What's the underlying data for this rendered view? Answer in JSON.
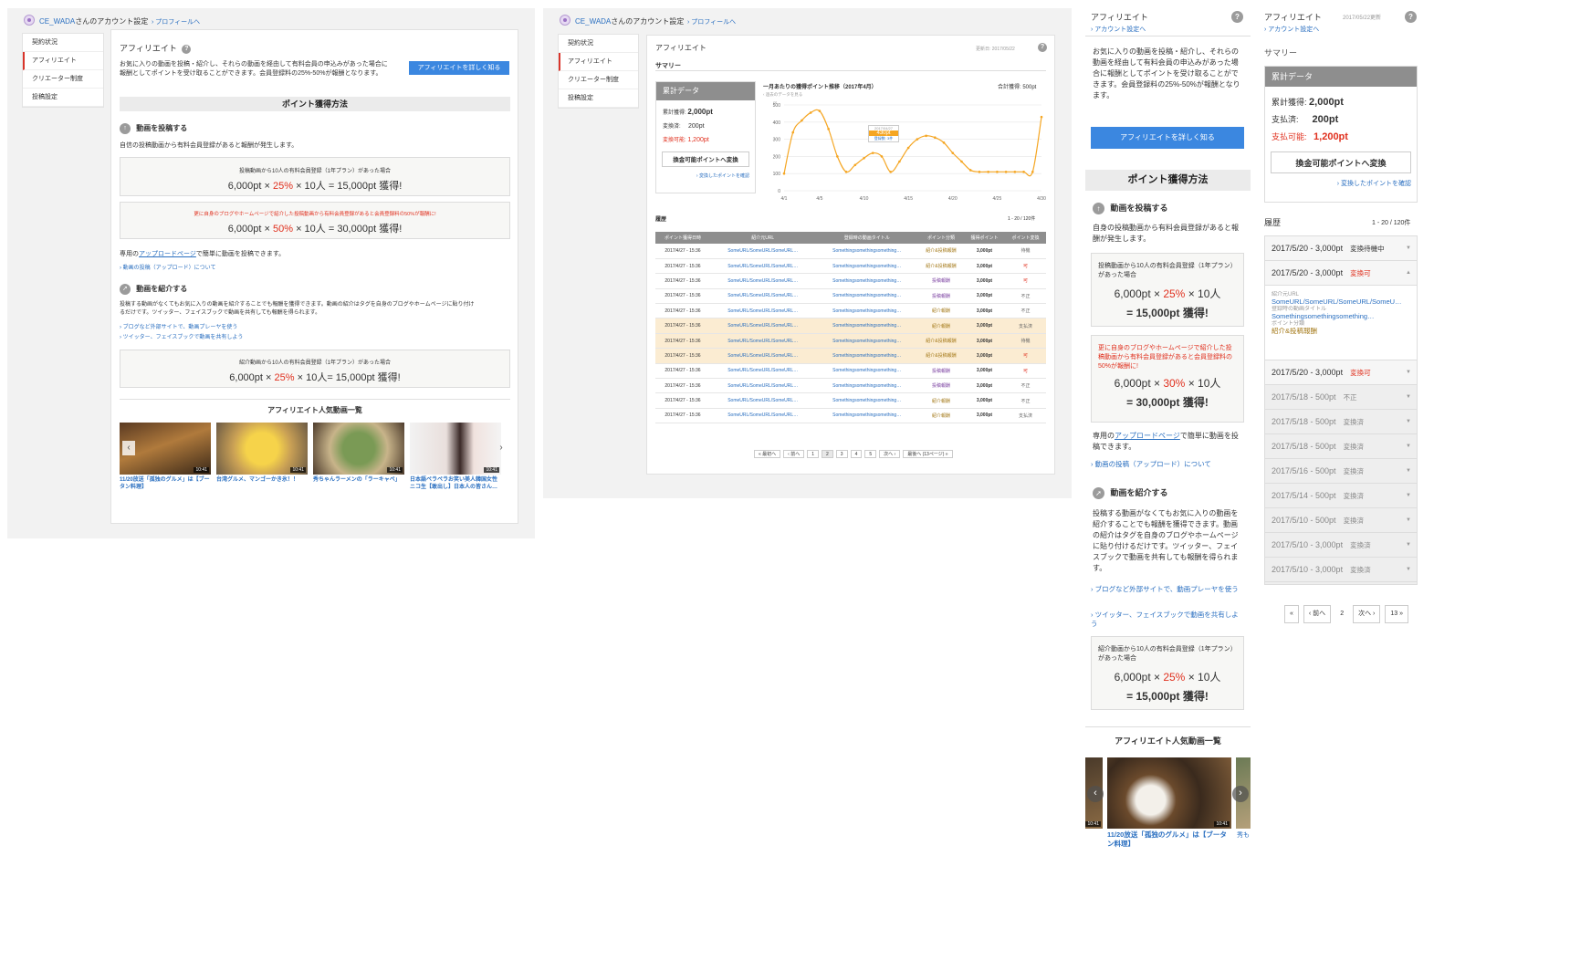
{
  "header": {
    "account_title": "CE_WADAさんのアカウント設定",
    "account_name": "CE_WADA",
    "account_suffix": "さんのアカウント設定",
    "profile_link": "プロフィールへ"
  },
  "sidenav": {
    "items": [
      "契約状況",
      "アフィリエイト",
      "クリエーター制度",
      "投稿設定"
    ]
  },
  "affiliate": {
    "title": "アフィリエイト",
    "help": "?",
    "intro": "お気に入りの動画を投稿・紹介し、それらの動画を経由して有料会員の申込みがあった場合に報酬としてポイントを受け取ることができます。会員登録料の25%-50%が報酬となります。",
    "intro_line1": "お気に入りの動画を投稿・紹介し、それらの動画を経由して有料会員の申込みがあった場合に",
    "intro_line2": "報酬としてポイントを受け取ることができます。会員登録料の25%-50%が報酬となります。",
    "learn_more": "アフィリエイトを詳しく知る",
    "method_title": "ポイント獲得方法",
    "post": {
      "title": "動画を投稿する",
      "desc": "自信の投稿動画から有料会員登録があると報酬が発生します。",
      "box1_caption": "投稿動画から10人の有料会員登録（1年プラン）があった場合",
      "box1_a": "6,000pt × ",
      "box1_pct": "25%",
      "box1_b": " × 10人 = 15,000pt 獲得!",
      "box2_caption": "更に自身のブログやホームページで紹介した投稿動画から有料会員登録があると会員登録料の50%が報酬に!",
      "box2_a": "6,000pt × ",
      "box2_pct": "50%",
      "box2_b": " × 10人 = 30,000pt 獲得!",
      "upload_pre": "専用の",
      "upload_link": "アップロードページ",
      "upload_post": "で簡単に動画を投稿できます。",
      "about_upload": "動画の投稿（アップロード）について"
    },
    "intro_video": {
      "title": "動画を紹介する",
      "desc": "投稿する動画がなくてもお気に入りの動画を紹介することでも報酬を獲得できます。動画の紹介はタグを自身のブログやホームページに貼り付けるだけです。ツイッター、フェイスブックで動画を共有しても報酬を得られます。",
      "desc_line1": "投稿する動画がなくてもお気に入りの動画を紹介することでも報酬を獲得できます。動画の紹介はタグを自身のブログやホームページに貼り付け",
      "desc_line2": "るだけです。ツイッター、フェイスブックで動画を共有しても報酬を得られます。",
      "link1": "ブログなど外部サイトで、動画プレーヤを使う",
      "link2": "ツイッター、フェイスブックで動画を共有しよう",
      "box_caption": "紹介動画から10人の有料会員登録（1年プラン）があった場合",
      "box_a": "6,000pt × ",
      "box_pct": "25%",
      "box_b": " × 10人= 15,000pt 獲得!"
    },
    "popular_title": "アフィリエイト人気動画一覧",
    "videos": [
      {
        "caption": "11/20放送「孤独のグルメ」は【ブータン料理】",
        "duration": "10:41"
      },
      {
        "caption": "台湾グルメ、マンゴーかき氷！！",
        "duration": "10:41"
      },
      {
        "caption": "秀ちゃんラーメンの「ラーキャベ」",
        "duration": "10:41"
      },
      {
        "caption": "日本語ペラペラお笑い美人韓国女性ニコ生【敢出し】日本人の皆さん…",
        "duration": "10:41"
      }
    ]
  },
  "summary_page": {
    "title": "アフィリエイト",
    "updated": "更新日: 2017/05/22",
    "summary_label": "サマリー",
    "stats_header": "累計データ",
    "total_label": "累計獲得:",
    "total_value": "2,000pt",
    "exchanged_label": "変換済:",
    "exchanged_value": "200pt",
    "available_label": "変換可能:",
    "available_value": "1,200pt",
    "convert_button": "換金可能ポイントへ変換",
    "confirm_link": "変換したポイントを確認",
    "chart_title": "一月あたりの獲得ポイント推移（2017年4月）",
    "chart_prev": "‹ 過去のデータを見る",
    "chart_total": "合計獲得: 500pt",
    "tooltip_date": "2017/04/27",
    "tooltip_value": "430pt",
    "tooltip_count": "登録数: 3件",
    "history_title": "履歴",
    "history_count": "1 - 20 / 120件",
    "columns": [
      "ポイント獲得日時",
      "紹介元URL",
      "登録時の動画タイトル",
      "ポイント分類",
      "獲得ポイント",
      "ポイント変換"
    ],
    "rows": [
      {
        "date": "2017/4/27 - 15:36",
        "url": "SomeURL/SomeURL/SomeURL…",
        "title": "Somethingsomethingsomething…",
        "type": "紹介&投稿報酬",
        "points": "3,000pt",
        "status": "待機",
        "hl": false
      },
      {
        "date": "2017/4/27 - 15:36",
        "url": "SomeURL/SomeURL/SomeURL…",
        "title": "Somethingsomethingsomething…",
        "type": "紹介&投稿報酬",
        "points": "3,000pt",
        "status": "可",
        "hl": false
      },
      {
        "date": "2017/4/27 - 15:36",
        "url": "SomeURL/SomeURL/SomeURL…",
        "title": "Somethingsomethingsomething…",
        "type": "投稿報酬",
        "points": "3,000pt",
        "status": "可",
        "hl": false
      },
      {
        "date": "2017/4/27 - 15:36",
        "url": "SomeURL/SomeURL/SomeURL…",
        "title": "Somethingsomethingsomething…",
        "type": "投稿報酬",
        "points": "3,000pt",
        "status": "不正",
        "hl": false
      },
      {
        "date": "2017/4/27 - 15:36",
        "url": "SomeURL/SomeURL/SomeURL…",
        "title": "Somethingsomethingsomething…",
        "type": "紹介報酬",
        "points": "3,000pt",
        "status": "不正",
        "hl": false
      },
      {
        "date": "2017/4/27 - 15:36",
        "url": "SomeURL/SomeURL/SomeURL…",
        "title": "Somethingsomethingsomething…",
        "type": "紹介報酬",
        "points": "3,000pt",
        "status": "支払済",
        "hl": true
      },
      {
        "date": "2017/4/27 - 15:36",
        "url": "SomeURL/SomeURL/SomeURL…",
        "title": "Somethingsomethingsomething…",
        "type": "紹介&投稿報酬",
        "points": "3,000pt",
        "status": "待機",
        "hl": true
      },
      {
        "date": "2017/4/27 - 15:36",
        "url": "SomeURL/SomeURL/SomeURL…",
        "title": "Somethingsomethingsomething…",
        "type": "紹介&投稿報酬",
        "points": "3,000pt",
        "status": "可",
        "hl": true
      },
      {
        "date": "2017/4/27 - 15:36",
        "url": "SomeURL/SomeURL/SomeURL…",
        "title": "Somethingsomethingsomething…",
        "type": "投稿報酬",
        "points": "3,000pt",
        "status": "可",
        "hl": false
      },
      {
        "date": "2017/4/27 - 15:36",
        "url": "SomeURL/SomeURL/SomeURL…",
        "title": "Somethingsomethingsomething…",
        "type": "投稿報酬",
        "points": "3,000pt",
        "status": "不正",
        "hl": false
      },
      {
        "date": "2017/4/27 - 15:36",
        "url": "SomeURL/SomeURL/SomeURL…",
        "title": "Somethingsomethingsomething…",
        "type": "紹介報酬",
        "points": "3,000pt",
        "status": "不正",
        "hl": false
      },
      {
        "date": "2017/4/27 - 15:36",
        "url": "SomeURL/SomeURL/SomeURL…",
        "title": "Somethingsomethingsomething…",
        "type": "紹介報酬",
        "points": "3,000pt",
        "status": "支払済",
        "hl": false
      }
    ],
    "pager": [
      "« 最初へ",
      "‹ 前へ",
      "1",
      "2",
      "3",
      "4",
      "5",
      "次へ ›",
      "最後へ (13ページ) »"
    ]
  },
  "chart_data": {
    "type": "line",
    "title": "一月あたりの獲得ポイント推移（2017年4月）",
    "xlabel": "",
    "ylabel": "pt",
    "ylim": [
      0,
      500
    ],
    "yticks": [
      0,
      100,
      200,
      300,
      400,
      500
    ],
    "xticks": [
      "4/1",
      "4/5",
      "4/10",
      "4/15",
      "4/20",
      "4/25",
      "4/30"
    ],
    "x": [
      1,
      2,
      3,
      4,
      5,
      6,
      7,
      8,
      9,
      10,
      11,
      12,
      13,
      14,
      15,
      16,
      17,
      18,
      19,
      20,
      21,
      22,
      23,
      24,
      25,
      26,
      27,
      28,
      29,
      30
    ],
    "values": [
      100,
      340,
      410,
      455,
      465,
      360,
      200,
      110,
      150,
      190,
      220,
      200,
      110,
      170,
      250,
      300,
      320,
      310,
      280,
      220,
      170,
      120,
      110,
      110,
      110,
      110,
      110,
      110,
      110,
      430
    ],
    "color": "#f5a623"
  },
  "mobile": {
    "title": "アフィリエイト",
    "back": "アカウント設定へ",
    "help": "?",
    "intro": "お気に入りの動画を投稿・紹介し、それらの動画を経由して有料会員の申込みがあった場合に報酬としてポイントを受け取ることができます。会員登録料の25%-50%が報酬となります。",
    "learn_more": "アフィリエイトを詳しく知る",
    "method_title": "ポイント獲得方法",
    "post_title": "動画を投稿する",
    "post_desc": "自身の投稿動画から有料会員登録があると報酬が発生します。",
    "box1_caption": "投稿動画から10人の有料会員登録（1年プラン）があった場合",
    "box1_line1a": "6,000pt × ",
    "box1_pct": "25%",
    "box1_line1b": " × 10人",
    "box1_line2": "= 15,000pt 獲得!",
    "box2_caption": "更に自身のブログやホームページで紹介した投稿動画から有料会員登録があると会員登録料の50%が報酬に!",
    "box2_line1a": "6,000pt × ",
    "box2_pct": "30%",
    "box2_line1b": " × 10人",
    "box2_line2": "= 30,000pt 獲得!",
    "upload_pre": "専用の",
    "upload_link": "アップロードページ",
    "upload_post": "で簡単に動画を投稿できます。",
    "about_upload": "動画の投稿（アップロード）について",
    "intro_title": "動画を紹介する",
    "intro_desc": "投稿する動画がなくてもお気に入りの動画を紹介することでも報酬を獲得できます。動画の紹介はタグを自身のブログやホームページに貼り付けるだけです。ツイッター、フェイスブックで動画を共有しても報酬を得られます。",
    "link1": "ブログなど外部サイトで、動画プレーヤを使う",
    "link2": "ツイッター、フェイスブックで動画を共有しよう",
    "box3_caption": "紹介動画から10人の有料会員登録（1年プラン）があった場合",
    "box3_line1a": "6,000pt × ",
    "box3_pct": "25%",
    "box3_line1b": " × 10人",
    "box3_line2": "= 15,000pt 獲得!",
    "popular_title": "アフィリエイト人気動画一覧",
    "video_caption": "11/20放送「孤独のグルメ」は【ブータン料理】",
    "video_duration": "10:41",
    "side_duration": "10:41",
    "side_caption": "秀も"
  },
  "mobile_summary": {
    "title": "アフィリエイト",
    "updated": "2017/05/22更新",
    "back": "アカウント設定へ",
    "help": "?",
    "summary_label": "サマリー",
    "stats_header": "累計データ",
    "total_label": "累計獲得:",
    "total_value": "2,000pt",
    "paid_label": "支払済:",
    "paid_value": "200pt",
    "available_label": "支払可能:",
    "available_value": "1,200pt",
    "convert_button": "換金可能ポイントへ変換",
    "confirm_link": "変換したポイントを確認",
    "history_title": "履歴",
    "history_count": "1 - 20 / 120件",
    "items": [
      {
        "date": "2017/5/20 - 3,000pt",
        "status": "変換待機中",
        "tone": "normal"
      },
      {
        "date": "2017/5/20 - 3,000pt",
        "status": "変換可",
        "tone": "red"
      },
      {
        "date": "2017/5/20 - 3,000pt",
        "status": "変換可",
        "tone": "red"
      },
      {
        "date": "2017/5/18 - 500pt",
        "status": "不正",
        "tone": "muted"
      },
      {
        "date": "2017/5/18 - 500pt",
        "status": "変換済",
        "tone": "muted"
      },
      {
        "date": "2017/5/18 - 500pt",
        "status": "変換済",
        "tone": "muted"
      },
      {
        "date": "2017/5/16 - 500pt",
        "status": "変換済",
        "tone": "muted"
      },
      {
        "date": "2017/5/14 - 500pt",
        "status": "変換済",
        "tone": "muted"
      },
      {
        "date": "2017/5/10 - 500pt",
        "status": "変換済",
        "tone": "muted"
      },
      {
        "date": "2017/5/10 - 3,000pt",
        "status": "変換済",
        "tone": "muted"
      },
      {
        "date": "2017/5/10 - 3,000pt",
        "status": "変換済",
        "tone": "muted"
      }
    ],
    "detail_url_label": "紹介元URL",
    "detail_url": "SomeURL/SomeURL/SomeURL/SomeU…",
    "detail_title_label": "登録時の動画タイトル",
    "detail_title": "Somethingsomethingsomething…",
    "detail_type_label": "ポイント分類",
    "detail_type": "紹介&投稿報酬",
    "pager": [
      "«",
      "‹ 前へ",
      "2",
      "次へ ›",
      "13 »"
    ]
  }
}
